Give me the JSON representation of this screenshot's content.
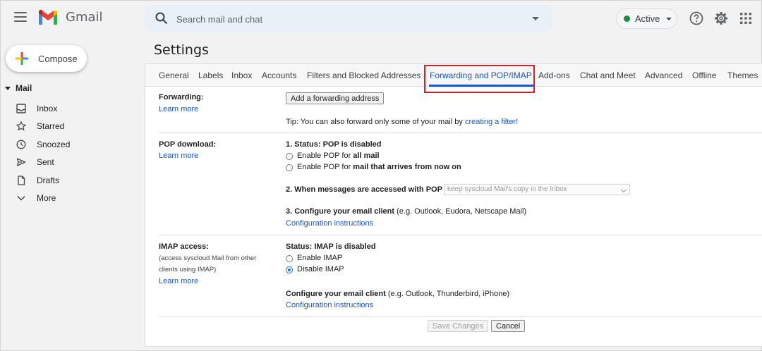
{
  "header": {
    "app_name": "Gmail",
    "search_placeholder": "Search mail and chat",
    "status_label": "Active",
    "status_color": "#1e8e3e"
  },
  "sidebar": {
    "compose_label": "Compose",
    "section_label": "Mail",
    "items": [
      {
        "label": "Inbox",
        "icon": "inbox-icon"
      },
      {
        "label": "Starred",
        "icon": "star-icon"
      },
      {
        "label": "Snoozed",
        "icon": "clock-icon"
      },
      {
        "label": "Sent",
        "icon": "send-icon"
      },
      {
        "label": "Drafts",
        "icon": "draft-icon"
      },
      {
        "label": "More",
        "icon": "chevron-down-icon"
      }
    ]
  },
  "page_title": "Settings",
  "tabs": [
    {
      "label": "General"
    },
    {
      "label": "Labels"
    },
    {
      "label": "Inbox"
    },
    {
      "label": "Accounts"
    },
    {
      "label": "Filters and Blocked Addresses"
    },
    {
      "label": "Forwarding and POP/IMAP",
      "active": true
    },
    {
      "label": "Add-ons"
    },
    {
      "label": "Chat and Meet"
    },
    {
      "label": "Advanced"
    },
    {
      "label": "Offline"
    },
    {
      "label": "Themes"
    }
  ],
  "forwarding": {
    "label": "Forwarding:",
    "learn_more": "Learn more",
    "add_button": "Add a forwarding address",
    "tip_prefix": "Tip: You can also forward only some of your mail by ",
    "tip_link": "creating a filter!"
  },
  "pop": {
    "label": "POP download:",
    "learn_more": "Learn more",
    "status": "1. Status: POP is disabled",
    "option1_prefix": "Enable POP for ",
    "option1_bold": "all mail",
    "option2_prefix": "Enable POP for ",
    "option2_bold": "mail that arrives from now on",
    "access_label": "2. When messages are accessed with POP",
    "access_select": "keep syscloud Mail's copy in the Inbox",
    "configure_bold": "3. Configure your email client",
    "configure_rest": " (e.g. Outlook, Eudora, Netscape Mail)",
    "config_link": "Configuration instructions"
  },
  "imap": {
    "label": "IMAP access:",
    "description": "(access syscloud Mail from other clients using IMAP)",
    "learn_more": "Learn more",
    "status": "Status: IMAP is disabled",
    "enable": "Enable IMAP",
    "disable": "Disable IMAP",
    "configure_bold": "Configure your email client",
    "configure_rest": " (e.g. Outlook, Thunderbird, iPhone)",
    "config_link": "Configuration instructions"
  },
  "footer": {
    "save": "Save Changes",
    "cancel": "Cancel"
  },
  "colors": {
    "highlight_box": "#d61f27",
    "link": "#1a55c0"
  }
}
